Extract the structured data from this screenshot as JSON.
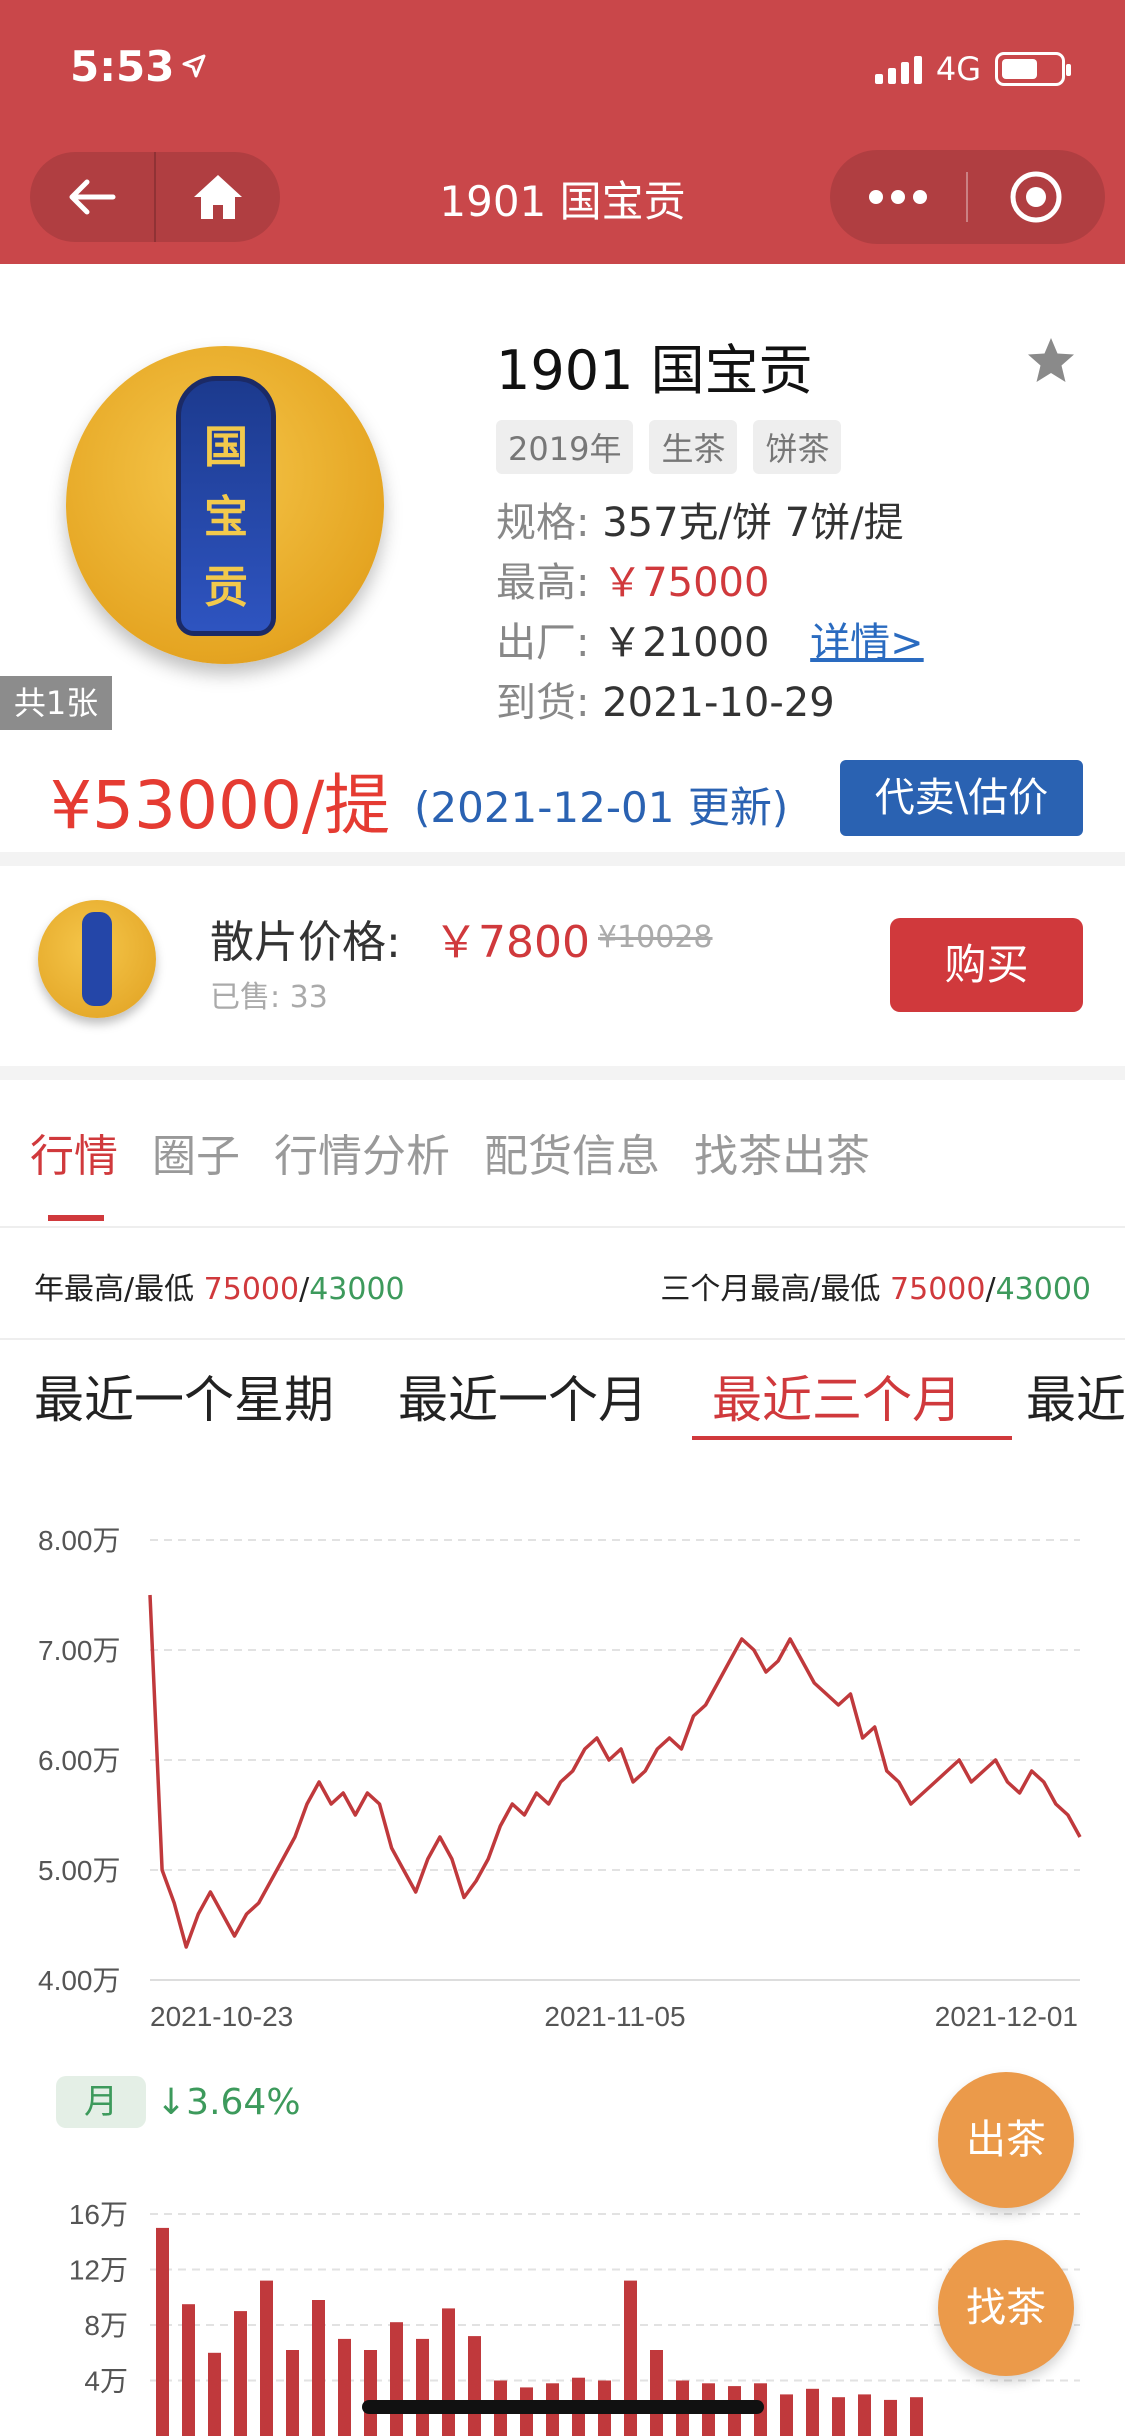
{
  "status": {
    "time": "5:53",
    "network": "4G"
  },
  "nav": {
    "title": "1901 国宝贡"
  },
  "product": {
    "name": "1901 国宝贡",
    "image_count": "共1张",
    "tags": [
      "2019年",
      "生茶",
      "饼茶"
    ],
    "spec_label": "规格:",
    "spec_value": "357克/饼 7饼/提",
    "highest_label": "最高:",
    "highest_value": "￥75000",
    "factory_label": "出厂:",
    "factory_value": "￥21000",
    "detail_link": "详情>",
    "arrival_label": "到货:",
    "arrival_value": "2021-10-29",
    "price": "¥53000/提",
    "update_note": "(2021-12-01 更新)",
    "sell_button": "代卖\\估价"
  },
  "piece": {
    "label": "散片价格:",
    "price": "￥7800",
    "original_price": "¥10028",
    "sold": "已售: 33",
    "buy_button": "购买"
  },
  "tabs": [
    "行情",
    "圈子",
    "行情分析",
    "配货信息",
    "找茶出茶"
  ],
  "stats": {
    "year_label": "年最高/最低",
    "year_high": "75000",
    "year_low": "43000",
    "quarter_label": "三个月最高/最低",
    "quarter_high": "75000",
    "quarter_low": "43000",
    "sep": "/"
  },
  "periods": [
    "最近一个星期",
    "最近一个月",
    "最近三个月",
    "最近"
  ],
  "colors": {
    "brand_red": "#c9474a",
    "price_red": "#d0393c",
    "green": "#3d9a5c",
    "blue": "#2a62b2",
    "orange": "#eb9a4a"
  },
  "chart_data": [
    {
      "type": "line",
      "y_tick_labels": [
        "8.00万",
        "7.00万",
        "6.00万",
        "5.00万",
        "4.00万"
      ],
      "x_tick_labels": [
        "2021-10-23",
        "2021-11-05",
        "2021-12-01"
      ],
      "ylim": [
        40000,
        80000
      ],
      "grid": true,
      "y": [
        75000,
        50000,
        47000,
        43000,
        46000,
        48000,
        46000,
        44000,
        46000,
        47000,
        49000,
        51000,
        53000,
        56000,
        58000,
        56000,
        57000,
        55000,
        57000,
        56000,
        52000,
        50000,
        48000,
        51000,
        53000,
        51000,
        47500,
        49000,
        51000,
        54000,
        56000,
        55000,
        57000,
        56000,
        58000,
        59000,
        61000,
        62000,
        60000,
        61000,
        58000,
        59000,
        61000,
        62000,
        61000,
        64000,
        65000,
        67000,
        69000,
        71000,
        70000,
        68000,
        69000,
        71000,
        69000,
        67000,
        66000,
        65000,
        66000,
        62000,
        63000,
        59000,
        58000,
        56000,
        57000,
        58000,
        59000,
        60000,
        58000,
        59000,
        60000,
        58000,
        57000,
        59000,
        58000,
        56000,
        55000,
        53000
      ]
    },
    {
      "type": "bar",
      "period_label": "月",
      "change": "↓3.64%",
      "y_tick_labels": [
        "16万",
        "12万",
        "8万",
        "4万"
      ],
      "ylim": [
        0,
        160000
      ],
      "values": [
        150000,
        95000,
        60000,
        90000,
        112000,
        62000,
        98000,
        70000,
        62000,
        82000,
        70000,
        92000,
        72000,
        40000,
        35000,
        38000,
        42000,
        40000,
        112000,
        62000,
        40000,
        38000,
        36000,
        38000,
        30000,
        34000,
        28000,
        30000,
        26000,
        28000
      ]
    }
  ],
  "fabs": {
    "sell": "出茶",
    "find": "找茶"
  }
}
